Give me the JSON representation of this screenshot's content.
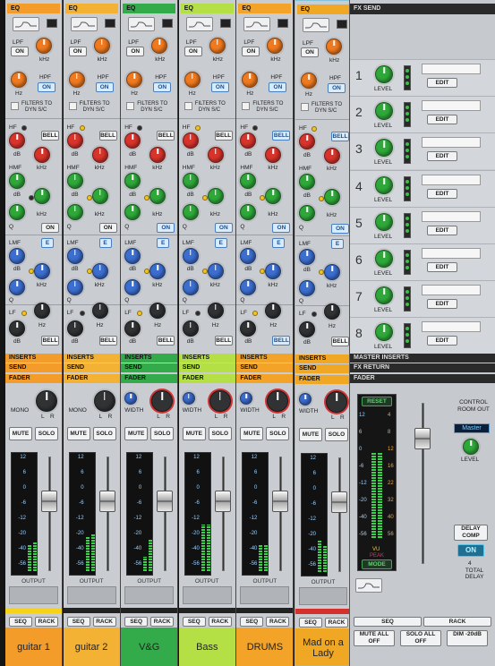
{
  "colors": {
    "accent_orange": "#f39422",
    "accent_green": "#35b247",
    "accent_lime": "#b4e046",
    "accent_red": "#d6302d"
  },
  "channels": [
    {
      "name": "guitar 1",
      "color": "#f39c2a",
      "meter": [
        0.22,
        0.25
      ],
      "fader_pct": 0.7,
      "type": "mono"
    },
    {
      "name": "guitar 2",
      "color": "#f3b233",
      "meter": [
        0.3,
        0.32
      ],
      "fader_pct": 0.7,
      "type": "mono"
    },
    {
      "name": "V&G",
      "color": "#33ab4a",
      "meter": [
        0.12,
        0.28
      ],
      "fader_pct": 0.7,
      "type": "stereo"
    },
    {
      "name": "Bass",
      "color": "#b4e046",
      "meter": [
        0.4,
        0.4
      ],
      "fader_pct": 0.7,
      "type": "stereo"
    },
    {
      "name": "DRUMS",
      "color": "#f3a428",
      "meter": [
        0.22,
        0.22
      ],
      "fader_pct": 0.7,
      "type": "stereo"
    },
    {
      "name": "Mad on a Lady",
      "color": "#f0a824",
      "meter": [
        0.27,
        0.22
      ],
      "fader_pct": 0.7,
      "type": "stereo"
    }
  ],
  "strip_labels": {
    "eq": "EQ",
    "lpf": "LPF",
    "hpf": "HPF",
    "on": "ON",
    "khz": "kHz",
    "hz": "Hz",
    "filters": "FILTERS TO",
    "dyn": "DYN S/C",
    "hf": "HF",
    "hmf": "HMF",
    "lmf": "LMF",
    "lf": "LF",
    "bell": "BELL",
    "db": "dB",
    "q": "Q",
    "e": "E",
    "inserts": "INSERTS",
    "send": "SEND",
    "fader": "FADER",
    "mono": "MONO",
    "width": "WIDTH",
    "l": "L",
    "r": "R",
    "mute": "MUTE",
    "solo": "SOLO",
    "output": "OUTPUT",
    "seq": "SEQ",
    "rack": "RACK",
    "scale": [
      "12",
      "6",
      "0",
      "-6",
      "-12",
      "-20",
      "-40",
      "-56"
    ]
  },
  "fx": {
    "title": "FX SEND",
    "sends": [
      {
        "num": "1",
        "level": "LEVEL",
        "edit": "EDIT"
      },
      {
        "num": "2",
        "level": "LEVEL",
        "edit": "EDIT"
      },
      {
        "num": "3",
        "level": "LEVEL",
        "edit": "EDIT"
      },
      {
        "num": "4",
        "level": "LEVEL",
        "edit": "EDIT"
      },
      {
        "num": "5",
        "level": "LEVEL",
        "edit": "EDIT"
      },
      {
        "num": "6",
        "level": "LEVEL",
        "edit": "EDIT"
      },
      {
        "num": "7",
        "level": "LEVEL",
        "edit": "EDIT"
      },
      {
        "num": "8",
        "level": "LEVEL",
        "edit": "EDIT"
      }
    ],
    "master_inserts": "MASTER INSERTS",
    "fx_return": "FX RETURN",
    "fader": "FADER",
    "reset": "RESET",
    "master_scale_left": [
      "12",
      "6",
      "0",
      "-6",
      "-12",
      "-20",
      "-40",
      "-56"
    ],
    "master_scale_right": [
      "4",
      "8",
      "12",
      "16",
      "22",
      "32",
      "40",
      "56"
    ],
    "vu": "VU",
    "peak": "PEAK",
    "mode": "MODE",
    "control_room_out": "CONTROL ROOM OUT",
    "master_select": "Master",
    "level": "LEVEL",
    "delay_comp": "DELAY COMP",
    "delay_on": "ON",
    "delay_value": "4",
    "total_delay": "TOTAL DELAY",
    "seq": "SEQ",
    "rack": "RACK",
    "mute_all_off": "MUTE ALL OFF",
    "solo_all_off": "SOLO ALL OFF",
    "dim": "DIM -20dB"
  }
}
